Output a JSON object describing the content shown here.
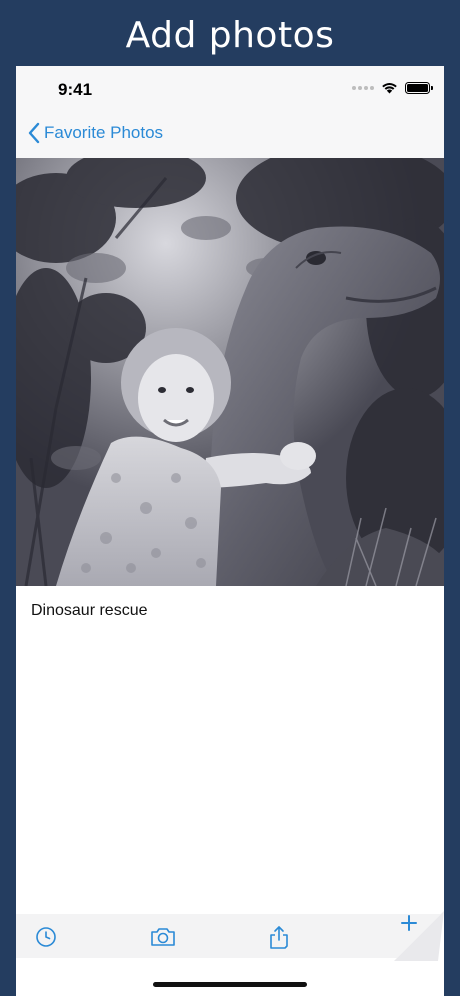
{
  "banner": {
    "title": "Add photos"
  },
  "status_bar": {
    "time": "9:41"
  },
  "nav": {
    "back_label": "Favorite Photos"
  },
  "photo": {
    "caption": "Dinosaur rescue"
  },
  "toolbar": {
    "history_icon": "clock-icon",
    "camera_icon": "camera-icon",
    "share_icon": "share-icon",
    "add_icon": "plus-icon"
  },
  "colors": {
    "background": "#243d60",
    "accent": "#2b8ad6",
    "bar": "#f7f7f8"
  }
}
